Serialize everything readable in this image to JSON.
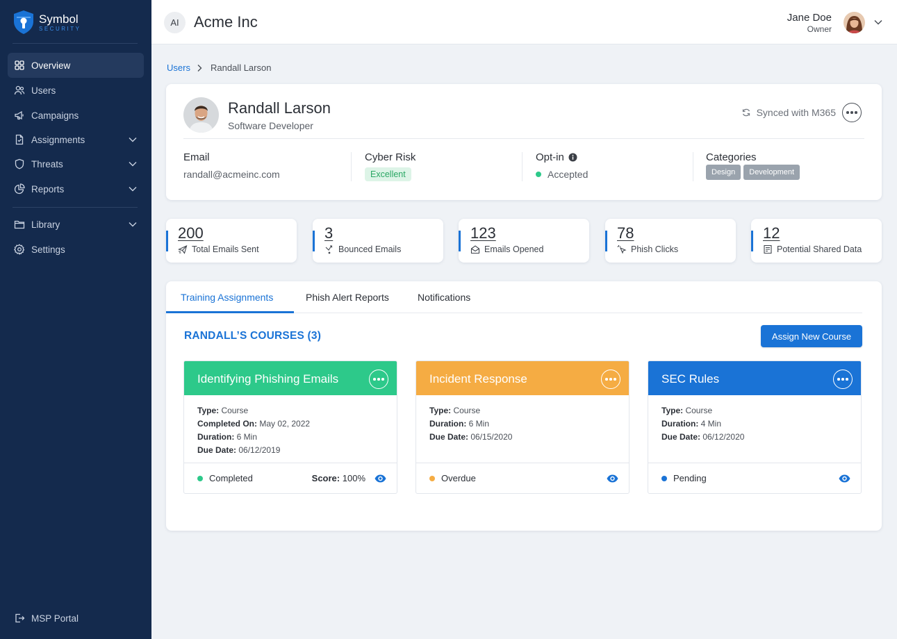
{
  "app": {
    "logo_main": "Symbol",
    "logo_sub": "SECURITY"
  },
  "sidebar": {
    "items": [
      {
        "label": "Overview",
        "icon": "grid-icon"
      },
      {
        "label": "Users",
        "icon": "users-icon"
      },
      {
        "label": "Campaigns",
        "icon": "megaphone-icon"
      },
      {
        "label": "Assignments",
        "icon": "document-icon"
      },
      {
        "label": "Threats",
        "icon": "shield-icon"
      },
      {
        "label": "Reports",
        "icon": "pie-chart-icon"
      },
      {
        "label": "Library",
        "icon": "folder-icon"
      },
      {
        "label": "Settings",
        "icon": "gear-icon"
      }
    ],
    "footer": {
      "label": "MSP Portal",
      "icon": "exit-icon"
    }
  },
  "header": {
    "org_initials": "AI",
    "org_name": "Acme Inc",
    "user_name": "Jane Doe",
    "user_role": "Owner"
  },
  "breadcrumb": {
    "parent": "Users",
    "current": "Randall Larson"
  },
  "profile": {
    "name": "Randall Larson",
    "title": "Software Developer",
    "sync_text": "Synced with M365",
    "email_label": "Email",
    "email": "randall@acmeinc.com",
    "risk_label": "Cyber Risk",
    "risk_value": "Excellent",
    "optin_label": "Opt-in",
    "optin_value": "Accepted",
    "categories_label": "Categories",
    "categories": [
      "Design",
      "Development"
    ]
  },
  "stats": [
    {
      "value": "200",
      "label": "Total Emails Sent",
      "icon": "sent-mail-icon"
    },
    {
      "value": "3",
      "label": "Bounced Emails",
      "icon": "bounce-icon"
    },
    {
      "value": "123",
      "label": "Emails Opened",
      "icon": "open-envelope-icon"
    },
    {
      "value": "78",
      "label": "Phish Clicks",
      "icon": "cursor-click-icon"
    },
    {
      "value": "12",
      "label": "Potential Shared Data",
      "icon": "document-list-icon"
    }
  ],
  "tabs": [
    "Training Assignments",
    "Phish Alert Reports",
    "Notifications"
  ],
  "courses_section": {
    "title": "RANDALL’S COURSES (3)",
    "assign_button": "Assign New Course"
  },
  "courses": [
    {
      "title": "Identifying Phishing Emails",
      "color": "#2dc98a",
      "fields": [
        {
          "k": "Type:",
          "v": "Course"
        },
        {
          "k": "Completed On:",
          "v": "May 02, 2022"
        },
        {
          "k": "Duration:",
          "v": "6 Min"
        },
        {
          "k": "Due Date:",
          "v": "06/12/2019"
        }
      ],
      "status": "Completed",
      "status_color": "#2dc98a",
      "score_label": "Score:",
      "score": "100%"
    },
    {
      "title": "Incident Response",
      "color": "#f5ac43",
      "fields": [
        {
          "k": "Type:",
          "v": "Course"
        },
        {
          "k": "Duration:",
          "v": "6 Min"
        },
        {
          "k": "Due Date:",
          "v": "06/15/2020"
        }
      ],
      "status": "Overdue",
      "status_color": "#f5ac43"
    },
    {
      "title": "SEC Rules",
      "color": "#1a73d6",
      "fields": [
        {
          "k": "Type:",
          "v": "Course"
        },
        {
          "k": "Duration:",
          "v": "4 Min"
        },
        {
          "k": "Due Date:",
          "v": "06/12/2020"
        }
      ],
      "status": "Pending",
      "status_color": "#1a73d6"
    }
  ],
  "colors": {
    "sidebar_bg": "#142a4d",
    "accent": "#1a73d6",
    "success": "#2dc98a",
    "warning": "#f5ac43"
  }
}
